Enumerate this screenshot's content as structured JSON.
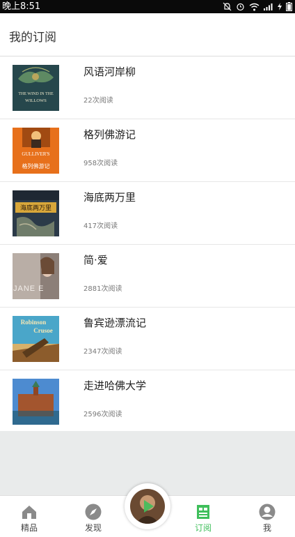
{
  "status_bar": {
    "time": "晚上8:51"
  },
  "header": {
    "title": "我的订阅"
  },
  "books": [
    {
      "title": "风语河岸柳",
      "reads": "22次阅读",
      "cover_text": [
        "THE WIND IN THE",
        "WILLOWS"
      ]
    },
    {
      "title": "格列佛游记",
      "reads": "958次阅读",
      "cover_text": [
        "GULLIVER'S",
        "格列佛游记"
      ]
    },
    {
      "title": "海底两万里",
      "reads": "417次阅读",
      "cover_text": [
        "海底两万里"
      ]
    },
    {
      "title": "简·爱",
      "reads": "2881次阅读",
      "cover_text": [
        "JANE E"
      ]
    },
    {
      "title": "鲁宾逊漂流记",
      "reads": "2347次阅读",
      "cover_text": [
        "Robinson",
        "Crusoe"
      ]
    },
    {
      "title": "走进哈佛大学",
      "reads": "2596次阅读",
      "cover_text": []
    }
  ],
  "tabs": [
    {
      "label": "精品",
      "icon": "home-icon"
    },
    {
      "label": "发现",
      "icon": "compass-icon"
    },
    {
      "label": "订阅",
      "icon": "subscribe-icon",
      "active": true
    },
    {
      "label": "我",
      "icon": "profile-icon"
    }
  ],
  "colors": {
    "accent": "#3fbf5b",
    "status_bar": "#0a0a0a",
    "background": "#e9ebeb"
  }
}
